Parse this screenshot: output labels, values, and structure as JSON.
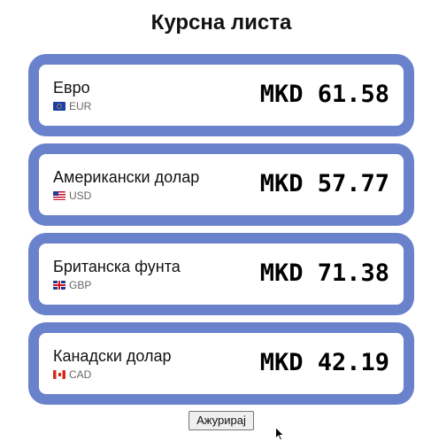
{
  "page": {
    "title": "Курсна листа"
  },
  "rates": [
    {
      "name": "Евро",
      "code": "EUR",
      "flag_icon": "eu-flag-icon",
      "value_text": "MKD 61.58"
    },
    {
      "name": "Американски долар",
      "code": "USD",
      "flag_icon": "us-flag-icon",
      "value_text": "MKD 57.77"
    },
    {
      "name": "Британска фунта",
      "code": "GBP",
      "flag_icon": "gb-flag-icon",
      "value_text": "MKD 71.38"
    },
    {
      "name": "Канадски долар",
      "code": "CAD",
      "flag_icon": "ca-flag-icon",
      "value_text": "MKD 42.19"
    }
  ],
  "actions": {
    "update_label": "Ажурирај"
  },
  "colors": {
    "card_frame": "#6a82cc",
    "card_inner": "#ffffff",
    "text": "#111111",
    "muted_text": "#666666"
  }
}
